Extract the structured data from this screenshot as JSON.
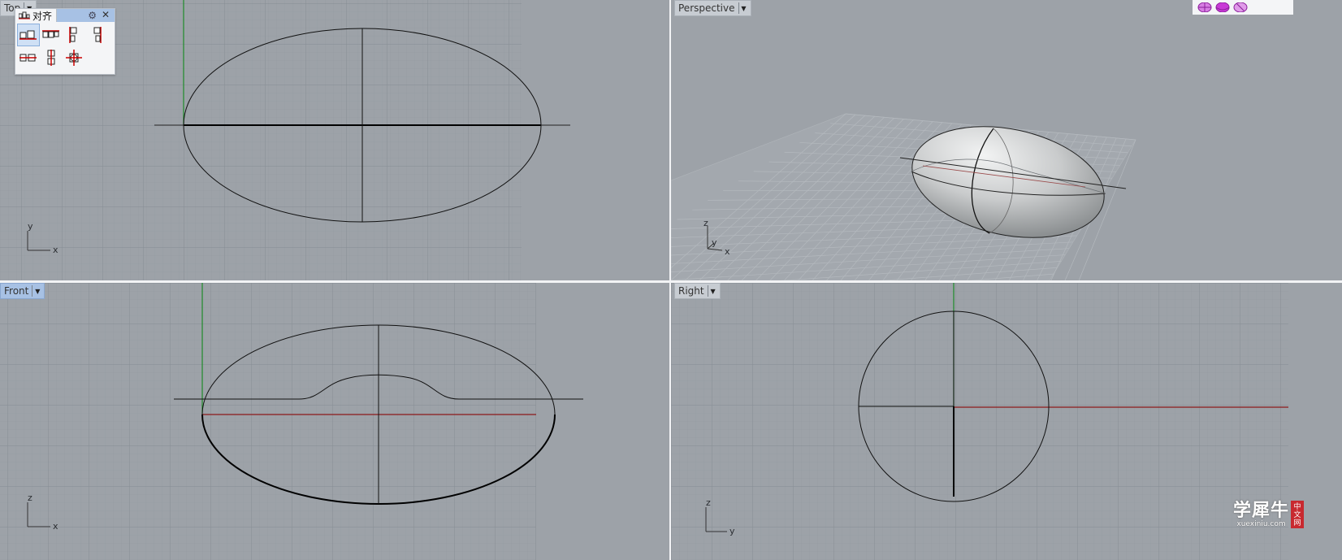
{
  "viewports": {
    "top": {
      "label": "Top",
      "axes": {
        "a": "y",
        "b": "x"
      }
    },
    "perspective": {
      "label": "Perspective",
      "axes": {
        "a": "z",
        "b": "y",
        "c": "x"
      }
    },
    "front": {
      "label": "Front",
      "axes": {
        "a": "z",
        "b": "x"
      }
    },
    "right": {
      "label": "Right",
      "axes": {
        "a": "z",
        "b": "y"
      }
    }
  },
  "align_panel": {
    "title": "对齐",
    "tools": [
      {
        "name": "align-bottom-tool-icon"
      },
      {
        "name": "align-top-tool-icon"
      },
      {
        "name": "align-left-tool-icon"
      },
      {
        "name": "align-right-tool-icon"
      },
      {
        "name": "align-center-horizontal-tool-icon"
      },
      {
        "name": "align-center-vertical-tool-icon"
      },
      {
        "name": "align-center-both-tool-icon"
      }
    ]
  },
  "watermark": {
    "main": "学犀牛",
    "sub": "xuexiniu.com",
    "badge": [
      "中",
      "文",
      "网"
    ]
  },
  "colors": {
    "viewport_bg": "#9da2a8",
    "active_tab": "#a7c1e4",
    "x_axis": "#8b1a1a",
    "y_axis": "#1f8a2a",
    "widget_accent": "#c83ad6"
  }
}
